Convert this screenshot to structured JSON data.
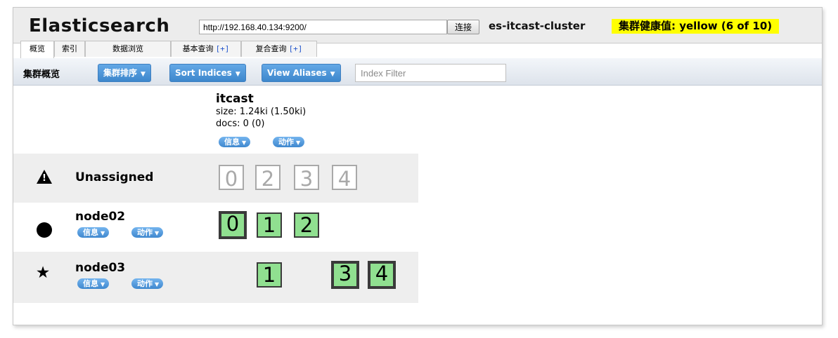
{
  "header": {
    "app_title": "Elasticsearch",
    "url_value": "http://192.168.40.134:9200/",
    "connect_label": "连接",
    "cluster_name": "es-itcast-cluster",
    "health_label": "集群健康值: yellow (6 of 10)",
    "health_color": "#ffff00"
  },
  "tabs": [
    {
      "label": "概览",
      "plus": ""
    },
    {
      "label": "索引",
      "plus": ""
    },
    {
      "label": "数据浏览",
      "plus": ""
    },
    {
      "label": "基本查询",
      "plus": "[+]"
    },
    {
      "label": "复合查询",
      "plus": "[+]"
    }
  ],
  "toolbar": {
    "title": "集群概览",
    "sort_cluster_label": "集群排序",
    "sort_indices_label": "Sort Indices",
    "view_aliases_label": "View Aliases",
    "filter_placeholder": "Index Filter"
  },
  "index": {
    "name": "itcast",
    "size": "size: 1.24ki (1.50ki)",
    "docs": "docs: 0 (0)",
    "info_label": "信息",
    "action_label": "动作"
  },
  "rows": {
    "unassigned": {
      "label": "Unassigned",
      "shards": [
        "0",
        "2",
        "3",
        "4"
      ]
    },
    "node02": {
      "name": "node02",
      "info_label": "信息",
      "action_label": "动作",
      "shards": [
        "0",
        "1",
        "2"
      ]
    },
    "node03": {
      "name": "node03",
      "info_label": "信息",
      "action_label": "动作",
      "shards": [
        "1",
        "3",
        "4"
      ]
    }
  },
  "colors": {
    "shard_fill": "#90e090",
    "button_blue": "#3d87cc"
  },
  "icons": {
    "unassigned": "warning-icon",
    "node02": "circle-icon",
    "node03": "star-icon"
  }
}
